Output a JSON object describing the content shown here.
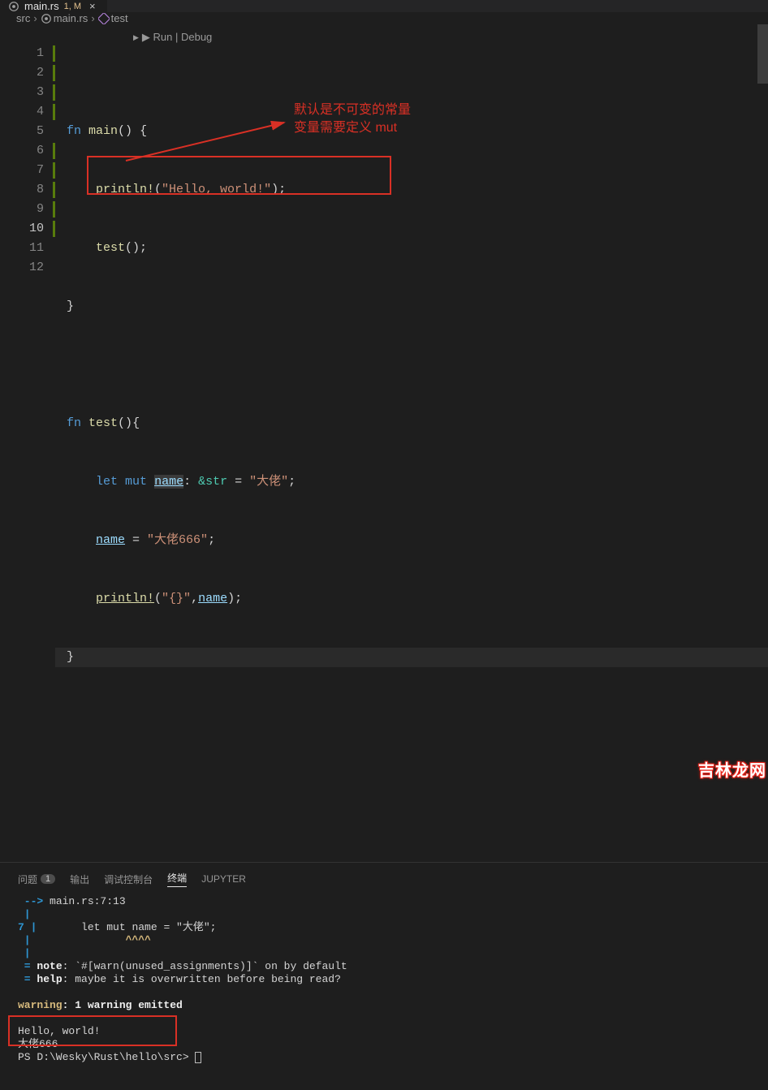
{
  "tab": {
    "filename": "main.rs",
    "status": "1, M",
    "close": "×"
  },
  "breadcrumb": {
    "folder": "src",
    "file": "main.rs",
    "symbol": "test"
  },
  "codelens": "▶ Run | Debug",
  "lineNumbers": [
    "1",
    "2",
    "3",
    "4",
    "5",
    "6",
    "7",
    "8",
    "9",
    "10",
    "11",
    "12"
  ],
  "code": {
    "l1": {
      "fn": "fn",
      "main": "main",
      "paren": "()",
      "brace": " {"
    },
    "l2": {
      "indent": "    ",
      "mac": "println!",
      "open": "(",
      "str": "\"Hello, world!\"",
      "close": ");"
    },
    "l3": {
      "indent": "    ",
      "call": "test",
      "after": "();"
    },
    "l4": {
      "brace": "}"
    },
    "l6": {
      "fn": "fn",
      "name": "test",
      "paren": "()",
      "brace": "{"
    },
    "l7": {
      "indent": "    ",
      "let": "let",
      "mut": "mut",
      "var": "name",
      "colon": ":",
      "type": "&str",
      "eq": " = ",
      "str": "\"大佬\"",
      "semi": ";"
    },
    "l8": {
      "indent": "    ",
      "var": "name",
      "eq": " = ",
      "str": "\"大佬666\"",
      "semi": ";"
    },
    "l9": {
      "indent": "    ",
      "mac": "println!",
      "open": "(",
      "fmt": "\"{}\"",
      "comma": ",",
      "var": "name",
      "close": ");"
    },
    "l10": {
      "brace": "}"
    }
  },
  "annotation": {
    "line1": "默认是不可变的常量",
    "line2": "变量需要定义 mut"
  },
  "terminalTabs": {
    "problems": "问题",
    "problemsCount": "1",
    "output": "输出",
    "debugConsole": "调试控制台",
    "terminal": "终端",
    "jupyter": "JUPYTER"
  },
  "terminal": {
    "arrow": " -->",
    "loc": " main.rs:7:13",
    "lineNum": "7",
    "pipe": " |",
    "codeLine": "       let mut name = \"大佬\";",
    "carets": "               ^^^^",
    "eq1": " =",
    "noteLabel": " note",
    "noteText": ": `#[warn(unused_assignments)]` on by default",
    "eq2": " =",
    "helpLabel": " help",
    "helpText": ": maybe it is overwritten before being read?",
    "warnLabel": "warning",
    "warnText": ": 1 warning emitted",
    "out1": "Hello, world!",
    "out2": "大佬666",
    "psPrompt": "PS D:\\Wesky\\Rust\\hello\\src> "
  },
  "watermark": "吉林龙网"
}
